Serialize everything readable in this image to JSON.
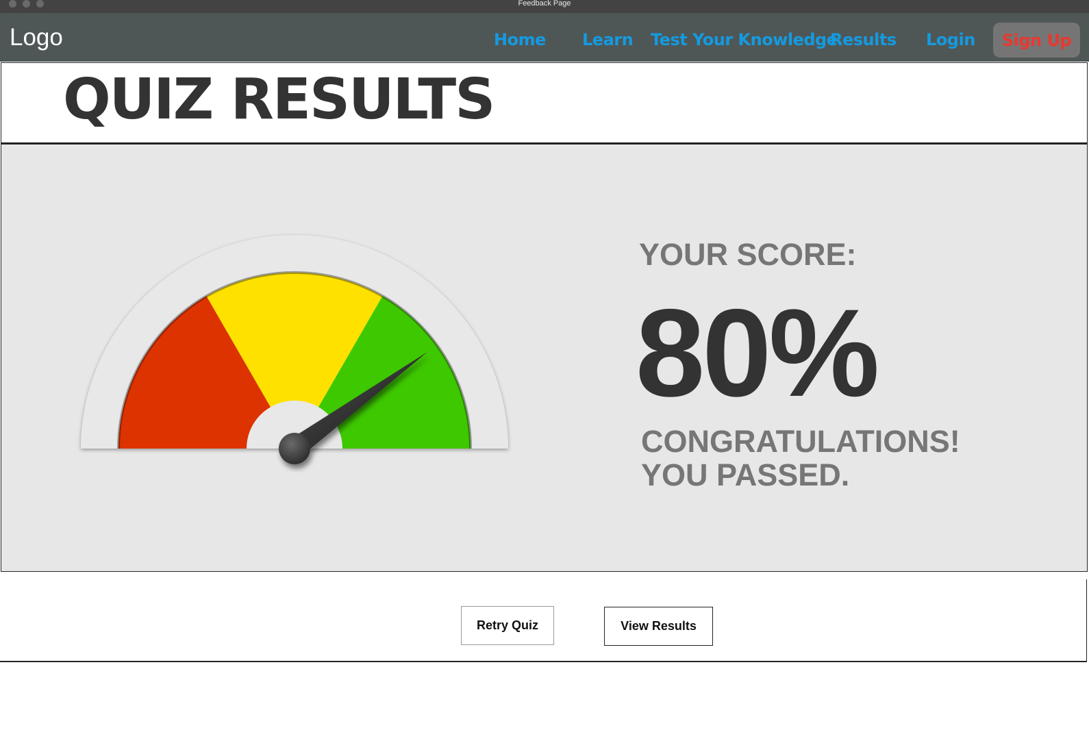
{
  "window": {
    "title": "Feedback Page"
  },
  "navbar": {
    "logo": "Logo",
    "links": [
      "Home",
      "Learn",
      "Test Your Knowledge",
      "Results",
      "Login"
    ],
    "signup_label": "Sign Up",
    "colors": {
      "background": "#4e5756",
      "link": "#159ae0",
      "signup_text": "#e8392f",
      "signup_bg": "#757575"
    }
  },
  "page": {
    "title": "QUIZ RESULTS"
  },
  "result": {
    "score_label": "YOUR SCORE:",
    "score_value": "80%",
    "score_fraction": 0.8,
    "congrats_line1": "CONGRATULATIONS!",
    "congrats_line2": "YOU PASSED.",
    "gauge_segment_colors": [
      "#dd3300",
      "#ffe100",
      "#3ec800"
    ]
  },
  "actions": {
    "retry_label": "Retry Quiz",
    "view_label": "View Results"
  }
}
